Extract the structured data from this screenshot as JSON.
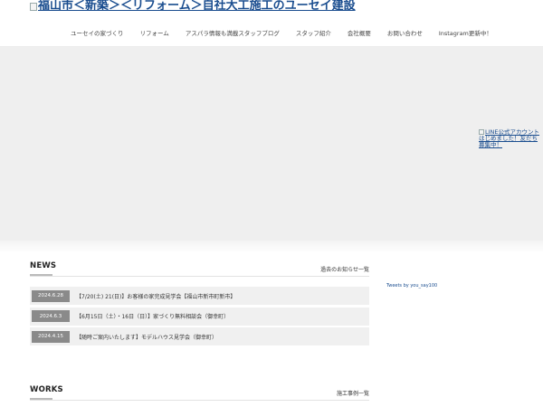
{
  "header": {
    "logo_alt": "福山市＜新築＞＜リフォーム＞自社大工施工のユーセイ建設"
  },
  "nav": {
    "items": [
      "ユーセイの家づくり",
      "リフォーム",
      "アスパラ情報も満載スタッフブログ",
      "スタッフ紹介",
      "会社概要",
      "お問い合わせ",
      "Instagram更新中！"
    ]
  },
  "line_badge": {
    "alt": "LINE公式アカウントはじめました！友だち募集中！"
  },
  "news": {
    "title": "NEWS",
    "archive_link": "過去のお知らせ一覧",
    "items": [
      {
        "date": "2024.6.28",
        "title": "【7/20(土) 21(日)】お客様の家完成見学会【福山市新市町新市】"
      },
      {
        "date": "2024.6.3",
        "title": "【6月15日（土）・16日（日）】家づくり無料相談会（御幸町）"
      },
      {
        "date": "2024.4.15",
        "title": "【随時ご案内いたします】モデルハウス見学会（御幸町）"
      }
    ]
  },
  "tweets": {
    "label": "Tweets by you_say100"
  },
  "works": {
    "title": "WORKS",
    "archive_link": "施工事例一覧"
  }
}
